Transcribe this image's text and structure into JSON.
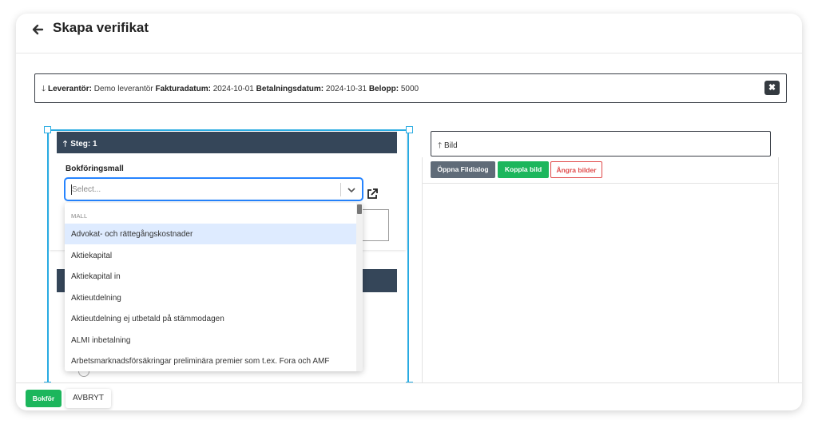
{
  "header": {
    "title": "Skapa verifikat"
  },
  "info_bar": {
    "leverantor_label": "Leverantör:",
    "leverantor_value": "Demo leverantör",
    "fakturadatum_label": "Fakturadatum:",
    "fakturadatum_value": "2024-10-01",
    "betalningsdatum_label": "Betalningsdatum:",
    "betalningsdatum_value": "2024-10-31",
    "belopp_label": "Belopp:",
    "belopp_value": "5000",
    "close_glyph": "✖"
  },
  "step": {
    "label": "Steg: 1",
    "field_label": "Bokföringsmall",
    "select_placeholder": "Select..."
  },
  "dropdown": {
    "group_label": "MALL",
    "items": [
      "Advokat- och rättegångskostnader",
      "Aktiekapital",
      "Aktiekapital in",
      "Aktieutdelning",
      "Aktieutdelning ej utbetald på stämmodagen",
      "ALMI inbetalning",
      "Arbetsmarknadsförsäkringar preliminära premier som t.ex. Fora och AMF"
    ],
    "active_index": 0
  },
  "bild": {
    "label": "Bild",
    "open_button": "Öppna Fildialog",
    "link_button": "Koppla bild",
    "undo_button": "Ångra bilder"
  },
  "footer": {
    "book_button": "Bokför",
    "cancel_button": "AVBRYT"
  },
  "colors": {
    "dark_header": "#354659",
    "green": "#1cb65c",
    "selection": "#29abe2",
    "danger": "#e04a4a"
  }
}
